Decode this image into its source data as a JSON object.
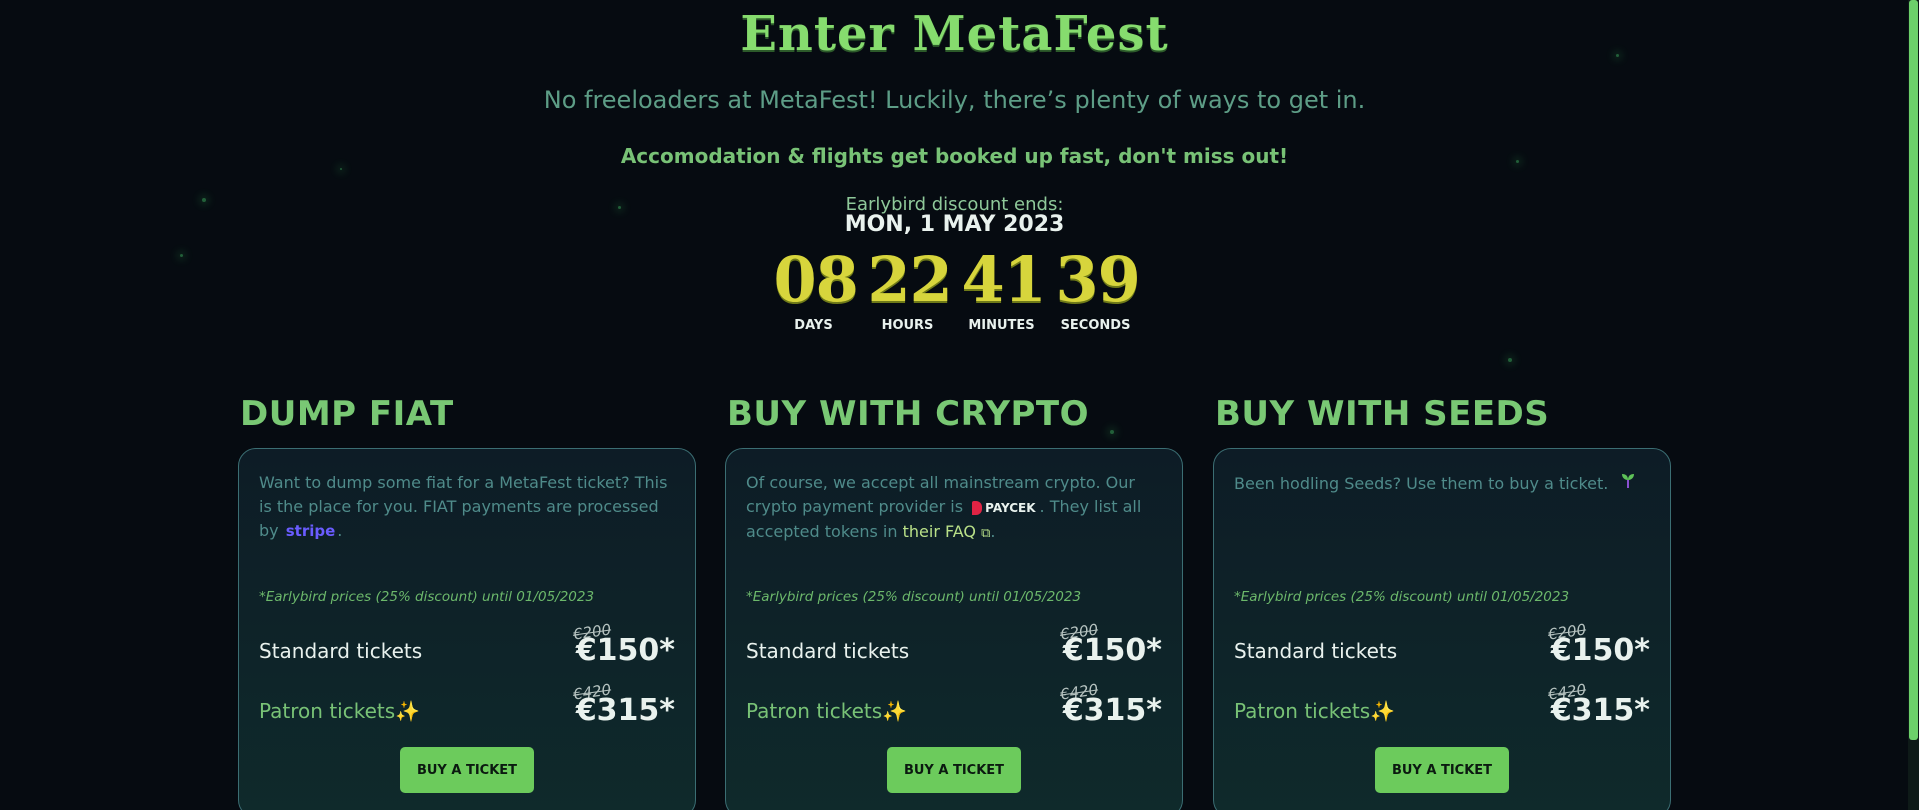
{
  "hero": {
    "title": "Enter MetaFest",
    "subtitle": "No freeloaders at MetaFest! Luckily, there’s plenty of ways to get in.",
    "warning": "Accomodation & flights get booked up fast, don't miss out!"
  },
  "countdown": {
    "label": "Earlybird discount ends:",
    "date": "MON, 1 MAY 2023",
    "units": [
      {
        "value": "08",
        "label": "DAYS"
      },
      {
        "value": "22",
        "label": "HOURS"
      },
      {
        "value": "41",
        "label": "MINUTES"
      },
      {
        "value": "39",
        "label": "SECONDS"
      }
    ]
  },
  "columns": [
    {
      "heading": "DUMP FIAT",
      "desc_pre": "Want to dump some fiat for a MetaFest ticket? This is the place for you. FIAT payments are processed by",
      "logo": "stripe",
      "desc_post": ".",
      "note": "*Earlybird prices (25% discount) until 01/05/2023",
      "standard": {
        "label": "Standard tickets",
        "old": "€200",
        "price": "€150*"
      },
      "patron": {
        "label": "Patron tickets✨",
        "old": "€420",
        "price": "€315*"
      },
      "button": "BUY A TICKET"
    },
    {
      "heading": "BUY WITH CRYPTO",
      "desc_pre": "Of course, we accept all mainstream crypto. Our crypto payment provider is",
      "logo": "PAYCEK",
      "desc_mid": ". They list all accepted tokens in",
      "link": "their FAQ",
      "desc_post": ".",
      "note": "*Earlybird prices (25% discount) until 01/05/2023",
      "standard": {
        "label": "Standard tickets",
        "old": "€200",
        "price": "€150*"
      },
      "patron": {
        "label": "Patron tickets✨",
        "old": "€420",
        "price": "€315*"
      },
      "button": "BUY A TICKET"
    },
    {
      "heading": "BUY WITH SEEDS",
      "desc_pre": "Been hodling Seeds? Use them to buy a ticket.",
      "note": "*Earlybird prices (25% discount) until 01/05/2023",
      "standard": {
        "label": "Standard tickets",
        "old": "€200",
        "price": "€150*"
      },
      "patron": {
        "label": "Patron tickets✨",
        "old": "€420",
        "price": "€315*"
      },
      "button": "BUY A TICKET"
    }
  ],
  "colors": {
    "accent": "#6ccb5c",
    "countdown": "#d7d53c",
    "background": "#060b11"
  }
}
